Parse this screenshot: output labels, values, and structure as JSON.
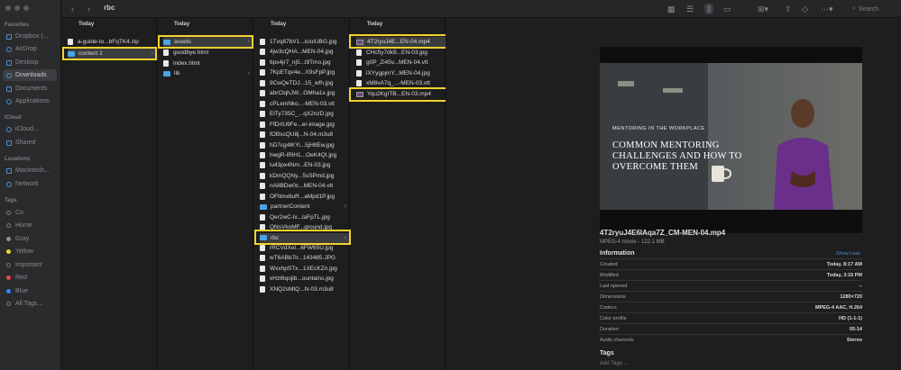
{
  "window": {
    "title": "rbc"
  },
  "toolbar": {
    "search_placeholder": "Search"
  },
  "sidebar": {
    "favorites_label": "Favorites",
    "favorites": [
      "Dropbox (...",
      "AirDrop",
      "Desktop",
      "Downloads",
      "Documents",
      "Applications"
    ],
    "icloud_label": "iCloud",
    "icloud": [
      "iCloud...",
      "Shared"
    ],
    "locations_label": "Locations",
    "locations": [
      "Macintosh...",
      "Network"
    ],
    "tags_label": "Tags",
    "tags": [
      {
        "label": "Co",
        "color": "#2a2b2d"
      },
      {
        "label": "Home",
        "color": "#2a2b2d"
      },
      {
        "label": "Gray",
        "color": "#8e8e93"
      },
      {
        "label": "Yellow",
        "color": "#f2d230"
      },
      {
        "label": "Important",
        "color": "#2a2b2d"
      },
      {
        "label": "Red",
        "color": "#e5484d"
      },
      {
        "label": "Blue",
        "color": "#3b82f6"
      },
      {
        "label": "All Tags...",
        "color": "#2a2b2d"
      }
    ]
  },
  "columns": [
    {
      "header": "Today",
      "items": [
        "a-guide-to...bFqTK4.zip",
        "content 2"
      ]
    },
    {
      "header": "Today",
      "items": [
        "assets",
        "goodbye.html",
        "index.html",
        "lib"
      ]
    },
    {
      "header": "Today",
      "items": [
        "1Tvq87bV1...iciuiUBG.jpg",
        "4jw3cQHA...MEN-04.jpg",
        "6ps4jr7_nj5...l9Tmo.jpg",
        "7KpETqv4e...X9sFpP.jpg",
        "9CwQeTDJ...15_wfh.jpg",
        "abrClqhJW...GMha1x.jpg",
        "cPLemNko...-MEN-03.vtt",
        "ElTy735C_...qX2nzD.jpg",
        "FfDrtU9Fe...er-image.jpg",
        "fOBscQU8j...N-04.m3u8",
        "hD7cg4lKYi...5jH8Ew.jpg",
        "hwgR-lRlH1...OeK4QI.jpg",
        "lu43px4Nm...EN-03.jpg",
        "kDmQQNy...5sSPmd.jpg",
        "nA8BDw0c...MEN-04.vtt",
        "OFltmx6uR...aMpd1P.jpg",
        "partnerContent",
        "Qer2wC-lx...laFpTL.jpg",
        "QNsVkoMF...ground.jpg",
        "rbc",
        "rRCVdXel...6FW65U.jpg",
        "wT6ABb7ir...143485.JPG",
        "WxxhpSTx...1XEcKZn.jpg",
        "xHzt6qojib...ountains.jpg",
        "XNQ2sMtQ...N-03.m3u8"
      ]
    },
    {
      "header": "Today",
      "items": [
        "4T2ryuJ4E...EN-04.mp4",
        "CHc5y7dk9...EN-03.jpg",
        "g0P_Zi45v...MEN-04.vtt",
        "lXYygpjmY...MEN-04.jpg",
        "xM8vA7q_...-MEN-03.vtt",
        "Yqu2KgITB...EN-03.mp4"
      ]
    }
  ],
  "preview": {
    "thumb_subtitle": "MENTORING IN THE WORKPLACE",
    "thumb_title": "COMMON MENTORING CHALLENGES AND HOW TO OVERCOME THEM",
    "file_name": "4T2ryuJ4E6IAqa7Z_CM-MEN-04.mp4",
    "file_type": "MPEG-4 movie - 122.1 MB",
    "info_label": "Information",
    "show_less": "Show Less",
    "info": [
      {
        "key": "Created",
        "value": "Today, 8:17 AM"
      },
      {
        "key": "Modified",
        "value": "Today, 3:15 PM"
      },
      {
        "key": "Last opened",
        "value": "--"
      },
      {
        "key": "Dimensions",
        "value": "1280×720"
      },
      {
        "key": "Codecs",
        "value": "MPEG-4 AAC, H.264"
      },
      {
        "key": "Color profile",
        "value": "HD (1-1-1)"
      },
      {
        "key": "Duration",
        "value": "05:14"
      },
      {
        "key": "Audio channels",
        "value": "Stereo"
      }
    ],
    "tags_label": "Tags",
    "add_tags": "Add Tags..."
  },
  "colors": {
    "highlight": "#f2d230",
    "accent": "#4f8fd0"
  }
}
